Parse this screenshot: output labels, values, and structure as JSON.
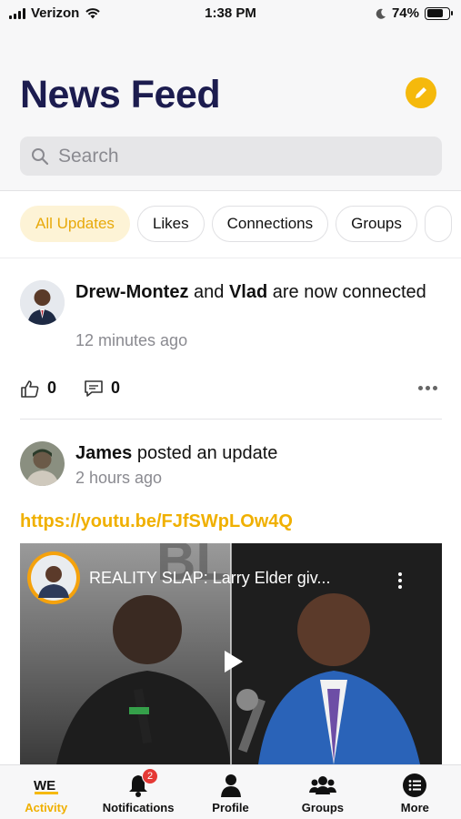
{
  "status_bar": {
    "carrier": "Verizon",
    "time": "1:38 PM",
    "battery_percent": "74%",
    "battery_level": 0.74
  },
  "header": {
    "title": "News Feed",
    "search_placeholder": "Search"
  },
  "filters": [
    {
      "label": "All Updates",
      "active": true
    },
    {
      "label": "Likes",
      "active": false
    },
    {
      "label": "Connections",
      "active": false
    },
    {
      "label": "Groups",
      "active": false
    }
  ],
  "posts": [
    {
      "user1": "Drew-Montez",
      "connector": "and",
      "user2": "Vlad",
      "action": "are now connected",
      "time": "12 minutes ago",
      "like_count": "0",
      "comment_count": "0"
    },
    {
      "user": "James",
      "action": "posted an update",
      "time": "2 hours ago",
      "link": "https://youtu.be/FJfSWpLOw4Q",
      "video_title": "REALITY SLAP: Larry Elder giv..."
    }
  ],
  "tabbar": [
    {
      "label": "Activity",
      "icon": "we-logo-icon",
      "active": true
    },
    {
      "label": "Notifications",
      "icon": "bell-icon",
      "badge": "2"
    },
    {
      "label": "Profile",
      "icon": "person-icon"
    },
    {
      "label": "Groups",
      "icon": "group-icon"
    },
    {
      "label": "More",
      "icon": "list-icon"
    }
  ],
  "colors": {
    "accent": "#f5b90c",
    "title": "#1c1c4f",
    "badge": "#e53935"
  }
}
